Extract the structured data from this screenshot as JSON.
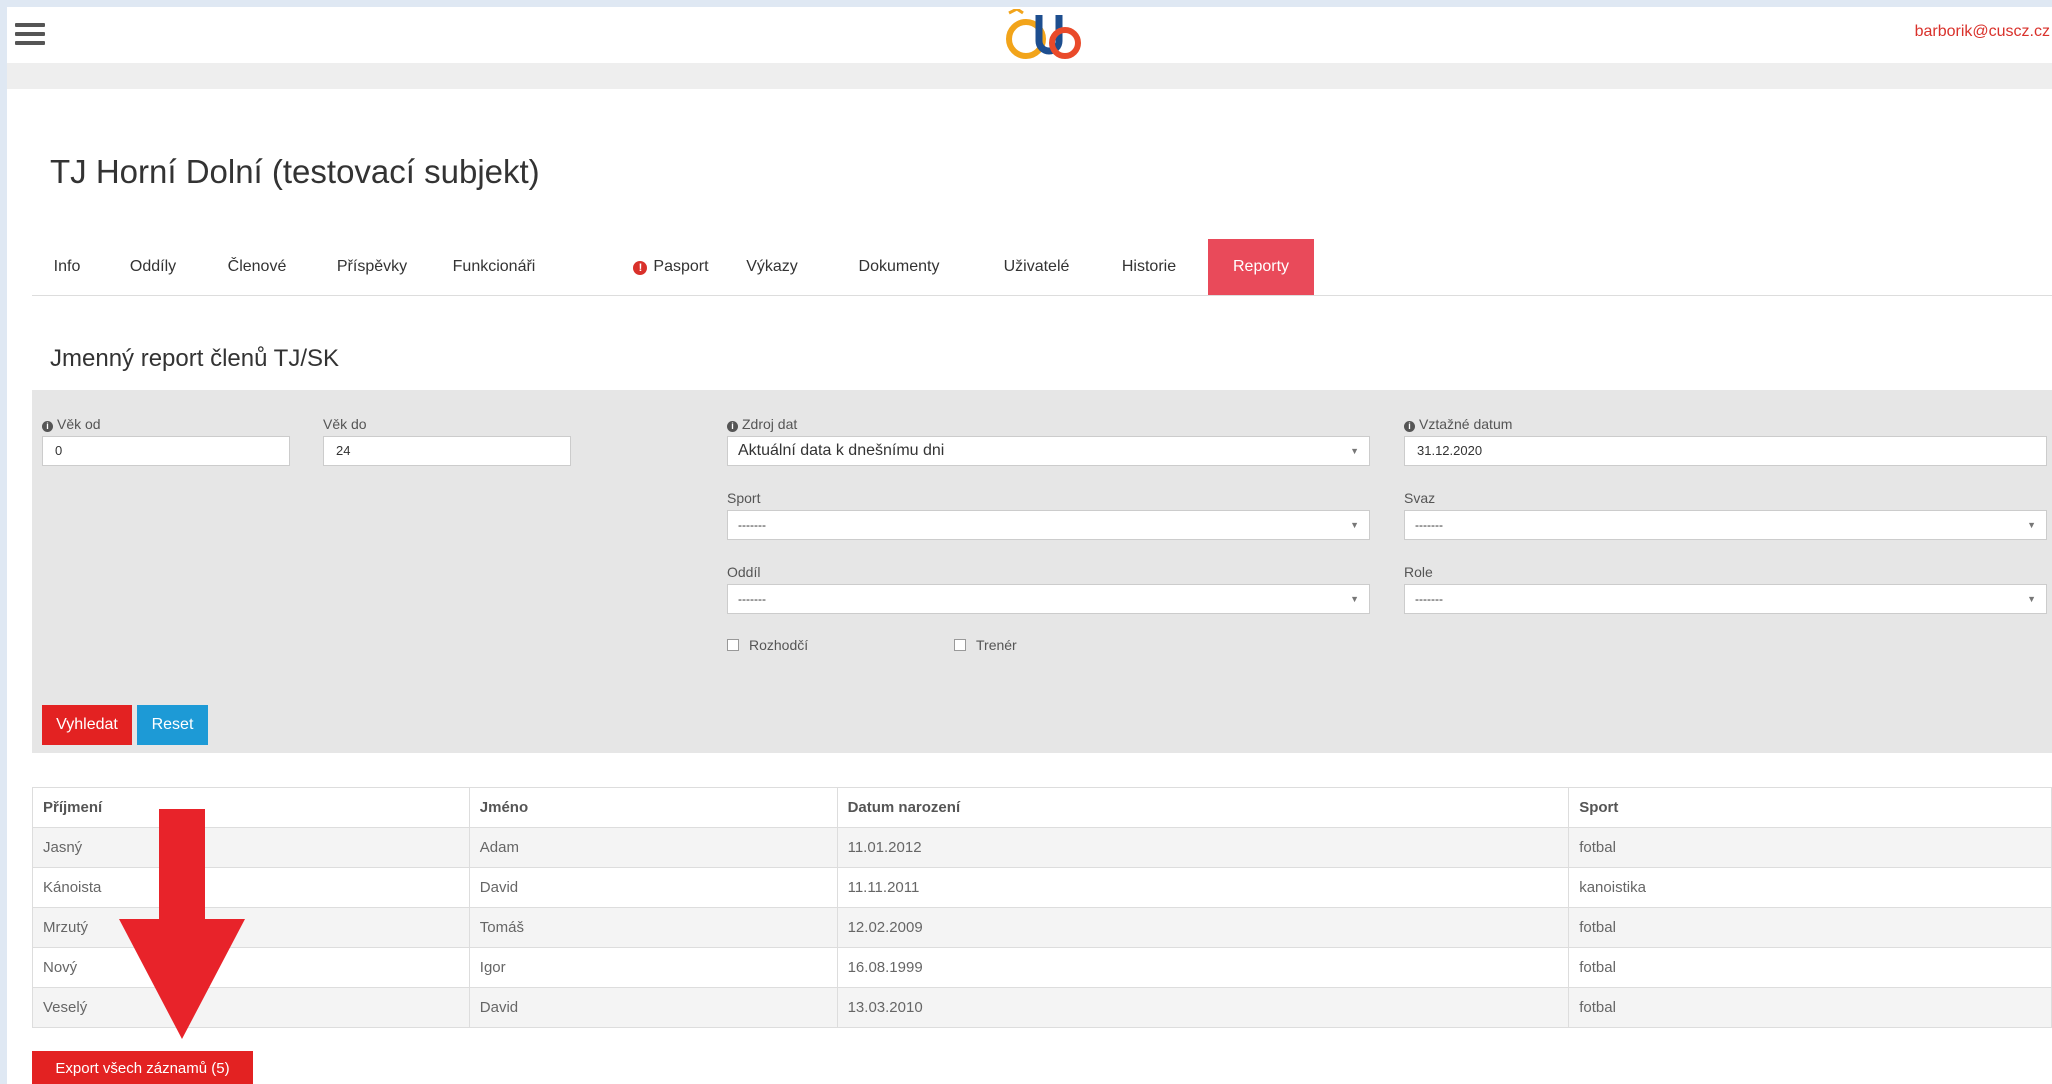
{
  "header": {
    "user_email": "barborik@cuscz.cz"
  },
  "page": {
    "title": "TJ Horní Dolní (testovací subjekt)"
  },
  "tabs": [
    {
      "label": "Info"
    },
    {
      "label": "Oddíly"
    },
    {
      "label": "Členové"
    },
    {
      "label": "Příspěvky"
    },
    {
      "label": "Funkcionáři"
    },
    {
      "label": "Pasport"
    },
    {
      "label": "Výkazy"
    },
    {
      "label": "Dokumenty"
    },
    {
      "label": "Uživatelé"
    },
    {
      "label": "Historie"
    },
    {
      "label": "Reporty"
    }
  ],
  "report": {
    "title": "Jmenný report členů TJ/SK",
    "filters": {
      "age_from": {
        "label": "Věk od",
        "value": "0"
      },
      "age_to": {
        "label": "Věk do",
        "value": "24"
      },
      "data_source": {
        "label": "Zdroj dat",
        "value": "Aktuální data k dnešnímu dni"
      },
      "ref_date": {
        "label": "Vztažné datum",
        "value": "31.12.2020"
      },
      "sport": {
        "label": "Sport",
        "value": "-------"
      },
      "union": {
        "label": "Svaz",
        "value": "-------"
      },
      "division": {
        "label": "Oddíl",
        "value": "-------"
      },
      "role": {
        "label": "Role",
        "value": "-------"
      },
      "referee": {
        "label": "Rozhodčí"
      },
      "coach": {
        "label": "Trenér"
      }
    },
    "search_label": "Vyhledat",
    "reset_label": "Reset"
  },
  "table": {
    "headers": [
      "Příjmení",
      "Jméno",
      "Datum narození",
      "Sport"
    ],
    "rows": [
      [
        "Jasný",
        "Adam",
        "11.01.2012",
        "fotbal"
      ],
      [
        "Kánoista",
        "David",
        "11.11.2011",
        "kanoistika"
      ],
      [
        "Mrzutý",
        "Tomáš",
        "12.02.2009",
        "fotbal"
      ],
      [
        "Nový",
        "Igor",
        "16.08.1999",
        "fotbal"
      ],
      [
        "Veselý",
        "David",
        "13.03.2010",
        "fotbal"
      ]
    ]
  },
  "export_label": "Export všech záznamů (5)",
  "colors": {
    "accent": "#e94a5a",
    "primary_button": "#e32222",
    "secondary_button": "#1d9ad6",
    "annotation_arrow": "#e8232a"
  }
}
